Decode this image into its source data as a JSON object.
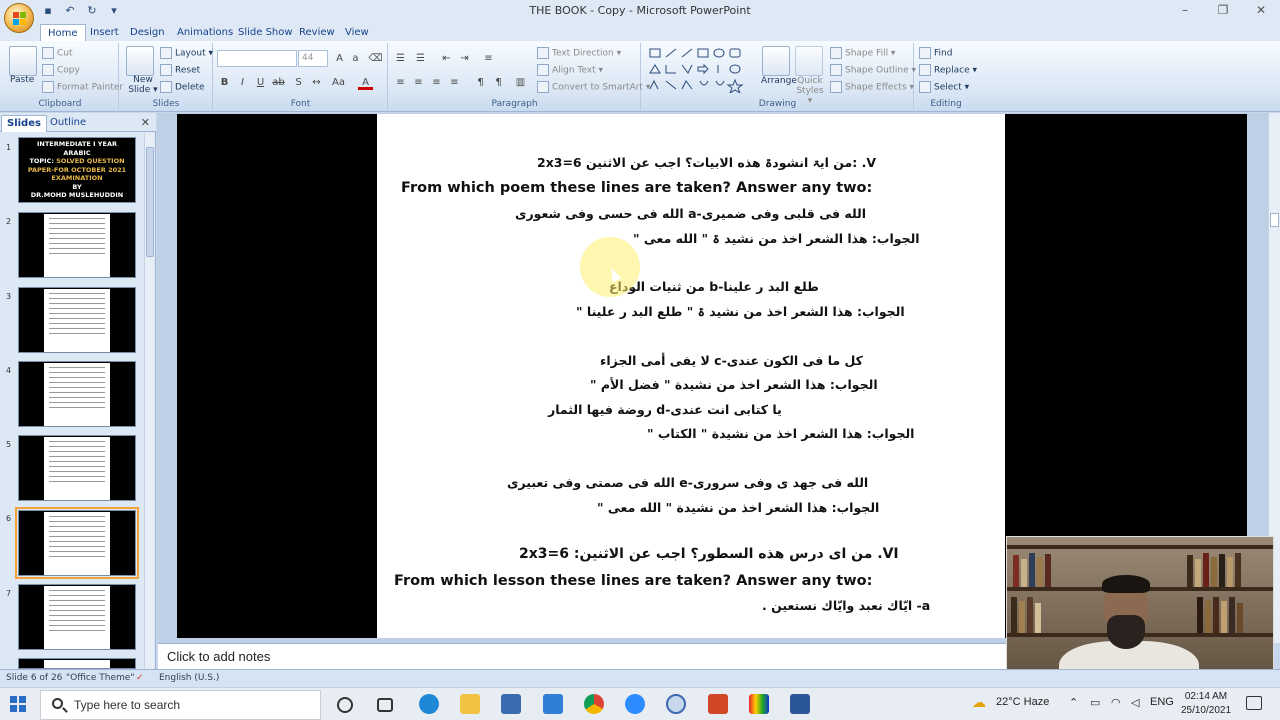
{
  "window": {
    "title": "THE BOOK - Copy - Microsoft PowerPoint",
    "controls": [
      "–",
      "❐",
      "✕"
    ]
  },
  "qat": [
    "save-icon",
    "undo-icon",
    "redo-icon",
    "customize-icon"
  ],
  "tabs": [
    "Home",
    "Insert",
    "Design",
    "Animations",
    "Slide Show",
    "Review",
    "View"
  ],
  "ribbon": {
    "clipboard": {
      "label": "Clipboard",
      "paste": "Paste",
      "cut": "Cut",
      "copy": "Copy",
      "format_painter": "Format Painter"
    },
    "slides": {
      "label": "Slides",
      "new_slide": "New Slide ▾",
      "layout": "Layout ▾",
      "reset": "Reset",
      "delete": "Delete"
    },
    "font": {
      "label": "Font",
      "size": "44"
    },
    "paragraph": {
      "label": "Paragraph",
      "text_direction": "Text Direction ▾",
      "align_text": "Align Text ▾",
      "convert": "Convert to SmartArt ▾"
    },
    "drawing": {
      "label": "Drawing",
      "arrange": "Arrange",
      "quick_styles": "Quick Styles ▾",
      "shape_fill": "Shape Fill ▾",
      "shape_outline": "Shape Outline ▾",
      "shape_effects": "Shape Effects ▾"
    },
    "editing": {
      "label": "Editing",
      "find": "Find",
      "replace": "Replace ▾",
      "select": "Select ▾"
    }
  },
  "panel": {
    "tabs": [
      "Slides",
      "Outline"
    ],
    "close": "✕",
    "slide_numbers": [
      "1",
      "2",
      "3",
      "4",
      "5",
      "6",
      "7"
    ],
    "slide1": {
      "l1": "INTERMEDIATE I YEAR",
      "l2": "ARABIC",
      "l3a": "TOPIC: ",
      "l3b": "SOLVED QUESTION",
      "l4": "PAPER-FOR OCTOBER 2021",
      "l5": "EXAMINATION",
      "l6": "BY",
      "l7": "DR.MOHD MUSLEHUDDIN"
    }
  },
  "slide_text": {
    "v_head": "2x3=6        من ايۃ انشودۃ هذه الابيات؟ اجب عن الاثنين:  .V",
    "v_en": "From which poem these lines are taken? Answer any two:",
    "a_line": "الله فى حسى وفى شعورى                   a-الله فى قلبى وفى ضميرى",
    "a_ans": "\" الجواب: هذا الشعر اخذ من نشيد ۃ \" الله معى",
    "b_line": "من ثنيات الوداع                    b-طلع البد ر علينا",
    "b_ans": "\" الجواب: هذا الشعر اخذ من نشيد ۃ \" طلع البد ر علينا",
    "c_line": "لا يفى أمى الجزاء                  c-كل ما فى الكون عندى",
    "c_ans": "\" الجواب: هذا الشعر اخذ من نشيدة \" فضل الأم",
    "d_line": "روضة فيها الثمار                    d-يا كتابى انت عندى",
    "d_ans": "\" الجواب: هذا الشعر اخذ من نشيدة \" الكتاب",
    "e_line": "الله فى صمتى وفى تعبيرى                e-الله فى جهد ى وفى سرورى",
    "e_ans": "\" الجواب: هذا الشعر اخذ من نشيدة \" الله معى",
    "vi_head": "2x3=6  :من اى درس هذه السطور؟ اجب عن الاثنين  .VI",
    "vi_en": "From which lesson these lines are taken? Answer any two:",
    "vi_a": ". ايّاك نعبد وايّاك نستعين -a"
  },
  "notes": {
    "placeholder": "Click to add notes"
  },
  "status": {
    "slide": "Slide 6 of 26",
    "theme": "\"Office Theme\"",
    "language": "English (U.S.)"
  },
  "taskbar": {
    "search_placeholder": "Type here to search",
    "weather": "22°C  Haze",
    "lang": "ENG",
    "time": "02:14 AM",
    "date": "25/10/2021"
  },
  "colors": {
    "selection": "#f2a23a",
    "ribbon_text": "#15428b",
    "cursor_halo": "#fff06e"
  }
}
